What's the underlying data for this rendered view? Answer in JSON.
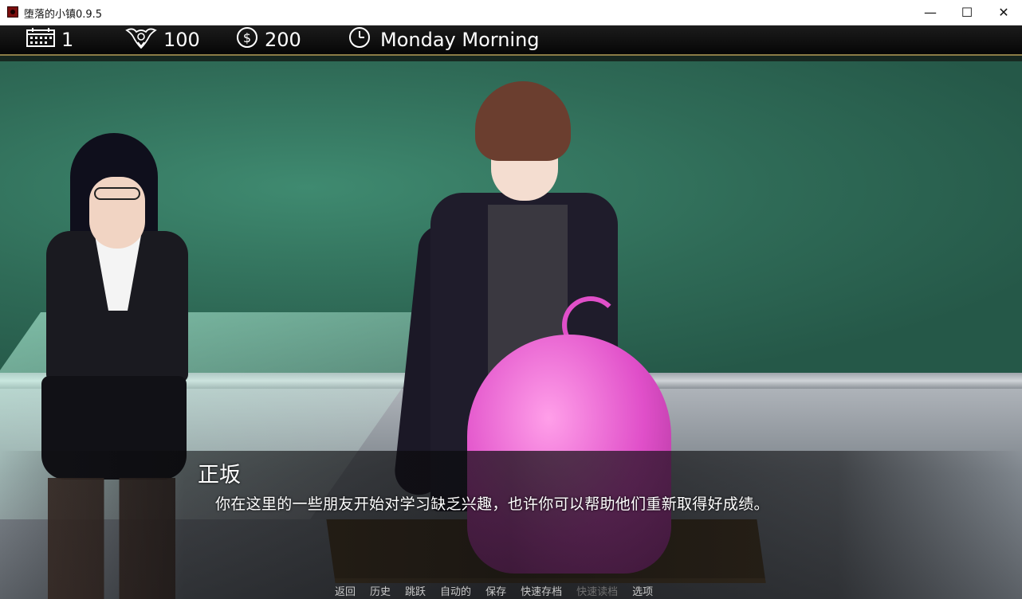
{
  "window": {
    "title": "堕落的小镇0.9.5",
    "minimize_glyph": "—",
    "maximize_glyph": "☐",
    "close_glyph": "✕"
  },
  "hud": {
    "day": "1",
    "corruption": "100",
    "money": "200",
    "time": "Monday Morning",
    "icons": [
      "calendar-icon",
      "demon-crest-icon",
      "dollar-coin-icon",
      "clock-icon"
    ]
  },
  "dialogue": {
    "speaker": "正坂",
    "text": "你在这里的一些朋友开始对学习缺乏兴趣，也许你可以帮助他们重新取得好成绩。"
  },
  "quick_menu": {
    "items": [
      "返回",
      "历史",
      "跳跃",
      "自动的",
      "保存",
      "快速存档",
      "快速读档",
      "选项"
    ],
    "disabled": [
      "快速读档"
    ]
  },
  "colors": {
    "hud_bg": "#0b0b0b",
    "hud_border": "#8c7c46",
    "chalkboard": "#2f6a56",
    "text": "#ffffff",
    "menu_text": "#c9c9c9",
    "menu_disabled": "#6f6f6f"
  }
}
